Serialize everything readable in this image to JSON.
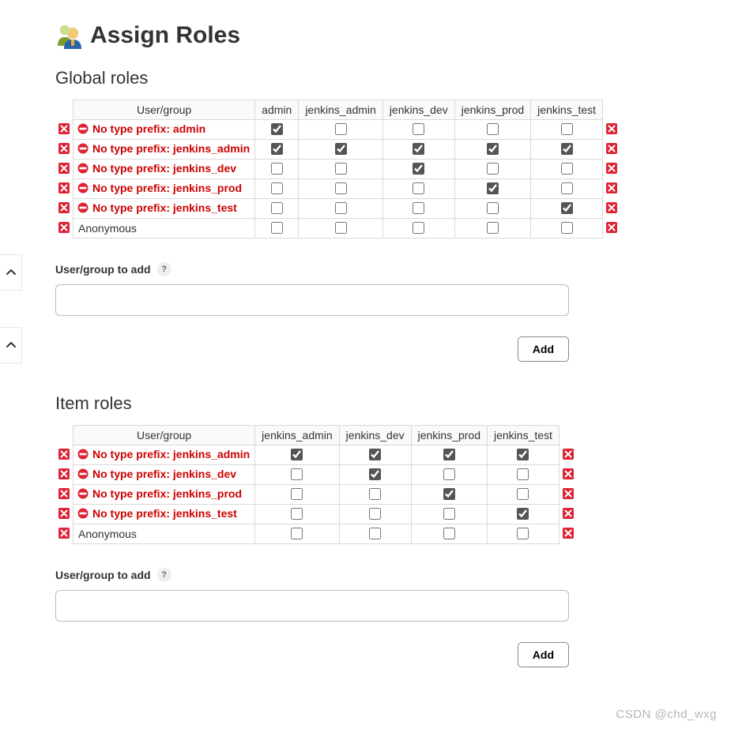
{
  "page_title": "Assign Roles",
  "watermark": "CSDN @chd_wxg",
  "sections": {
    "global": {
      "heading": "Global roles",
      "usergroup_header": "User/group",
      "columns": [
        "admin",
        "jenkins_admin",
        "jenkins_dev",
        "jenkins_prod",
        "jenkins_test"
      ],
      "rows": [
        {
          "label": "No type prefix: admin",
          "warn": true,
          "checks": [
            true,
            false,
            false,
            false,
            false
          ]
        },
        {
          "label": "No type prefix: jenkins_admin",
          "warn": true,
          "checks": [
            true,
            true,
            true,
            true,
            true
          ]
        },
        {
          "label": "No type prefix: jenkins_dev",
          "warn": true,
          "checks": [
            false,
            false,
            true,
            false,
            false
          ]
        },
        {
          "label": "No type prefix: jenkins_prod",
          "warn": true,
          "checks": [
            false,
            false,
            false,
            true,
            false
          ]
        },
        {
          "label": "No type prefix: jenkins_test",
          "warn": true,
          "checks": [
            false,
            false,
            false,
            false,
            true
          ]
        },
        {
          "label": "Anonymous",
          "warn": false,
          "checks": [
            false,
            false,
            false,
            false,
            false
          ]
        }
      ],
      "add_label": "User/group to add",
      "add_placeholder": "",
      "add_help": "?",
      "add_button": "Add"
    },
    "item": {
      "heading": "Item roles",
      "usergroup_header": "User/group",
      "columns": [
        "jenkins_admin",
        "jenkins_dev",
        "jenkins_prod",
        "jenkins_test"
      ],
      "rows": [
        {
          "label": "No type prefix: jenkins_admin",
          "warn": true,
          "checks": [
            true,
            true,
            true,
            true
          ]
        },
        {
          "label": "No type prefix: jenkins_dev",
          "warn": true,
          "checks": [
            false,
            true,
            false,
            false
          ]
        },
        {
          "label": "No type prefix: jenkins_prod",
          "warn": true,
          "checks": [
            false,
            false,
            true,
            false
          ]
        },
        {
          "label": "No type prefix: jenkins_test",
          "warn": true,
          "checks": [
            false,
            false,
            false,
            true
          ]
        },
        {
          "label": "Anonymous",
          "warn": false,
          "checks": [
            false,
            false,
            false,
            false
          ]
        }
      ],
      "add_label": "User/group to add",
      "add_placeholder": "",
      "add_help": "?",
      "add_button": "Add"
    }
  }
}
